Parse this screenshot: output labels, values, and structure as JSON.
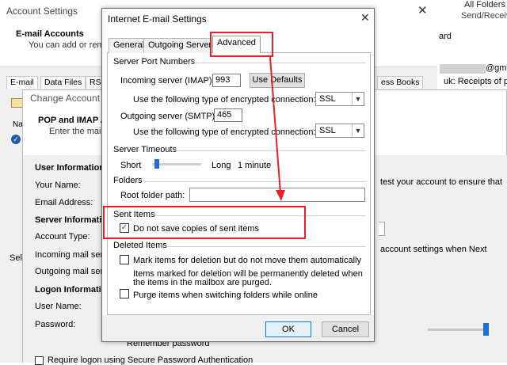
{
  "account_settings": {
    "title": "Account Settings",
    "header_title": "E-mail Accounts",
    "header_sub": "You can add or remo",
    "tabs": [
      "E-mail",
      "Data Files",
      "RSS",
      "ess Books"
    ],
    "list_header": "Na",
    "select_hint": "Sele"
  },
  "outlook_bg": {
    "all_folders": "All Folders",
    "send_receive": "Send/Receive",
    "ard": "ard",
    "email_partial": "@gma",
    "uk_line": "uk: Receipts of pay"
  },
  "change_account": {
    "title": "Change Account",
    "header_title": "POP and IMAP A",
    "header_sub": "Enter the mail",
    "user_information": "User Information",
    "your_name": "Your Name:",
    "email_address": "Email Address:",
    "server_information": "Server Informatio",
    "account_type": "Account Type:",
    "incoming_mail": "Incoming mail serv",
    "outgoing_mail": "Outgoing mail ser",
    "logon_information": "Logon Informatio",
    "user_name": "User Name:",
    "password": "Password:",
    "remember_password": "Remember password",
    "require_logon": "Require logon using Secure Password Authentication",
    "test_line1": "test your account to ensure that",
    "test_line2": "",
    "next_line": "account settings when Next"
  },
  "dialog": {
    "title": "Internet E-mail Settings",
    "close": "✕",
    "tabs": {
      "general": "General",
      "outgoing": "Outgoing Server",
      "advanced": "Advanced"
    },
    "server_ports": {
      "group_label": "Server Port Numbers",
      "incoming_label": "Incoming server (IMAP):",
      "incoming_value": "993",
      "use_defaults": "Use Defaults",
      "encryption_label_1": "Use the following type of encrypted connection:",
      "encryption_value_1": "SSL",
      "outgoing_label": "Outgoing server (SMTP):",
      "outgoing_value": "465",
      "encryption_label_2": "Use the following type of encrypted connection:",
      "encryption_value_2": "SSL"
    },
    "timeouts": {
      "group_label": "Server Timeouts",
      "short": "Short",
      "long": "Long",
      "value": "1 minute",
      "slider_level": 0.05
    },
    "folders": {
      "group_label": "Folders",
      "root_label": "Root folder path:",
      "root_value": ""
    },
    "sent_items": {
      "group_label": "Sent Items",
      "do_not_save": "Do not save copies of sent items",
      "checked": true
    },
    "deleted_items": {
      "group_label": "Deleted Items",
      "mark_items": "Mark items for deletion but do not move them automatically",
      "permanent_line1": "Items marked for deletion will be permanently deleted when",
      "permanent_line2": "the items in the mailbox are purged.",
      "purge": "Purge items when switching folders while online"
    },
    "buttons": {
      "ok": "OK",
      "cancel": "Cancel"
    }
  },
  "annotation": {
    "color": "#e8202a"
  }
}
